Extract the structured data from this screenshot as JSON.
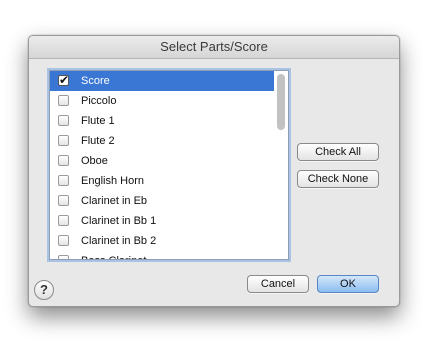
{
  "dialog": {
    "title": "Select Parts/Score"
  },
  "parts_list": {
    "items": [
      {
        "label": "Score",
        "checked": true,
        "selected": true
      },
      {
        "label": "Piccolo",
        "checked": false,
        "selected": false
      },
      {
        "label": "Flute 1",
        "checked": false,
        "selected": false
      },
      {
        "label": "Flute 2",
        "checked": false,
        "selected": false
      },
      {
        "label": "Oboe",
        "checked": false,
        "selected": false
      },
      {
        "label": "English Horn",
        "checked": false,
        "selected": false
      },
      {
        "label": "Clarinet in Eb",
        "checked": false,
        "selected": false
      },
      {
        "label": "Clarinet in Bb 1",
        "checked": false,
        "selected": false
      },
      {
        "label": "Clarinet in Bb 2",
        "checked": false,
        "selected": false
      },
      {
        "label": "Bass Clarinet",
        "checked": false,
        "selected": false
      }
    ]
  },
  "buttons": {
    "check_all": "Check All",
    "check_none": "Check None",
    "cancel": "Cancel",
    "ok": "OK",
    "help": "?"
  },
  "icons": {
    "help": "question-mark",
    "checkmark": "check"
  },
  "colors": {
    "selection": "#3a77d4",
    "focus_ring": "#a9c3e4",
    "default_button": "#8cbcf0"
  }
}
